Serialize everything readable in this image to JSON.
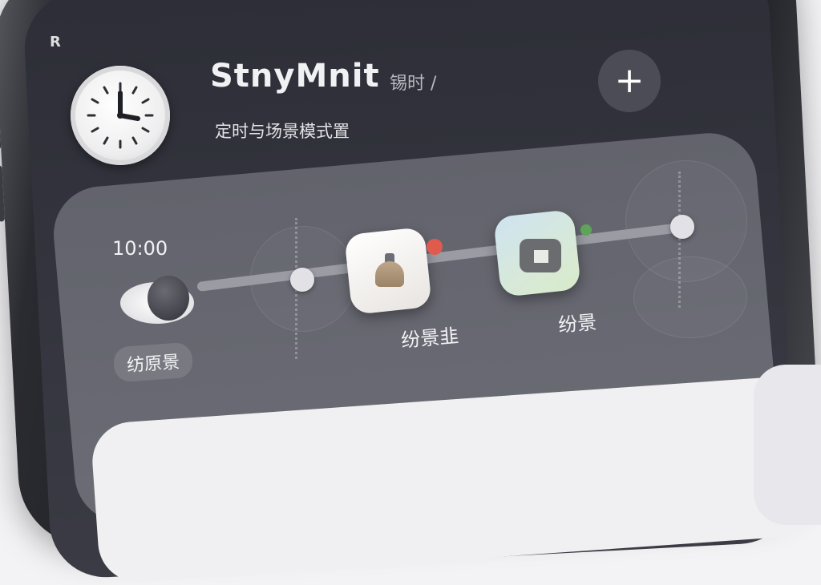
{
  "status_bar": {
    "text": "R"
  },
  "header": {
    "title": "StnyMnit",
    "title_note": "锡时 /",
    "subtitle": "定时与场景模式置",
    "add_button_label": "+",
    "clock_icon": "clock-icon"
  },
  "timeline": {
    "time": "10:00",
    "start_tag": "纺原景",
    "items": [
      {
        "label": "纷景韭",
        "icon": "bell-icon",
        "badge_color": "#e05a4e"
      },
      {
        "label": "纷景",
        "icon": "home-bag-icon",
        "badge_color": "#5fa35a"
      }
    ]
  },
  "colors": {
    "background": "#2d2e37",
    "panel": "#676871",
    "track": "#9a9ba3",
    "accent_red": "#e05a4e",
    "accent_green": "#5fa35a"
  }
}
